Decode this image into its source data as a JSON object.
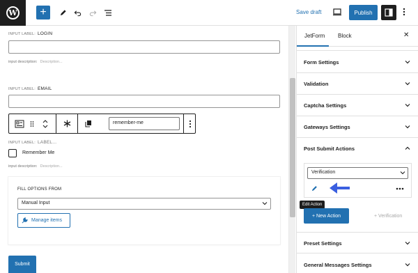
{
  "topbar": {
    "save_draft": "Save draft",
    "publish": "Publish",
    "add_symbol": "+"
  },
  "form": {
    "login": {
      "label_prefix": "INPUT LABEL:",
      "label": "LOGIN",
      "desc_prefix": "input description:",
      "desc_placeholder": "Description..."
    },
    "email": {
      "label_prefix": "INPUT LABEL:",
      "label": "EMAIL"
    },
    "block_toolbar": {
      "field_name": "remember-me"
    },
    "checkbox": {
      "label_prefix": "INPUT LABEL:",
      "label": "LABEL...",
      "option": "Remember Me",
      "desc_prefix": "input description:",
      "desc_placeholder": "Description..."
    },
    "fill_options": {
      "title": "FILL OPTIONS FROM",
      "selected": "Manual Input",
      "manage_label": "Manage items"
    },
    "submit": "Submit"
  },
  "sidebar": {
    "tabs": [
      "JetForm",
      "Block"
    ],
    "close": "✕",
    "panels_top": [
      "Form Settings",
      "Validation",
      "Captcha Settings",
      "Gateways Settings",
      "Post Submit Actions"
    ],
    "action_select": "Verification",
    "tooltip": "Edit Action",
    "new_action": "+ New Action",
    "verification_link": "+ Verification",
    "panels_bottom": [
      "Preset Settings",
      "General Messages Settings"
    ]
  },
  "colors": {
    "accent": "#2271b1",
    "annotation_arrow": "#3a5fe0",
    "dark": "#1e1e1e"
  }
}
